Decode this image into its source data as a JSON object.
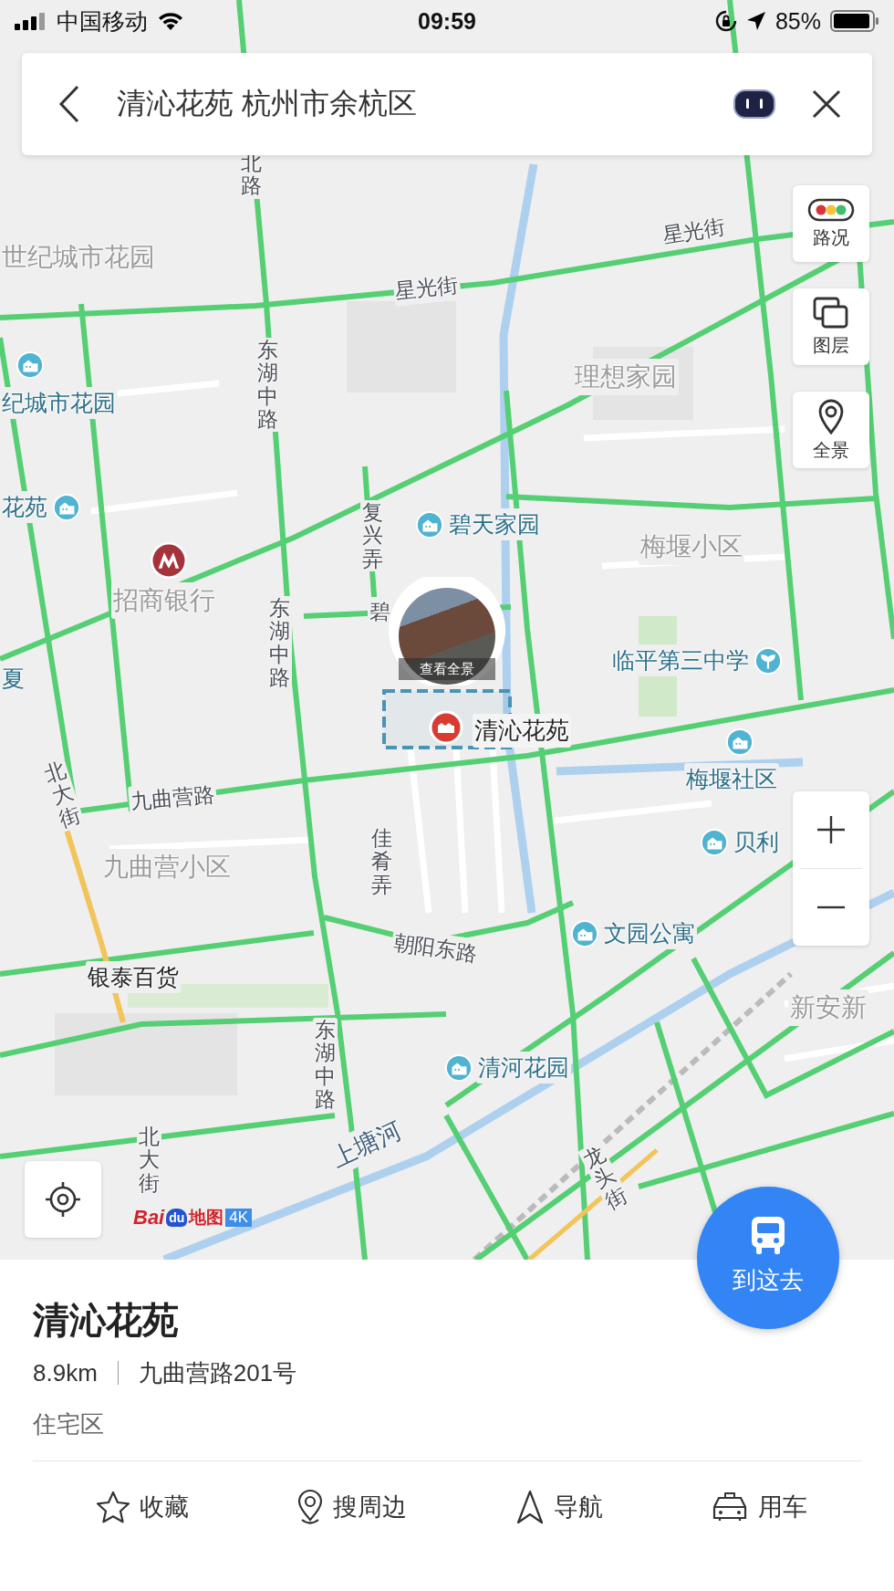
{
  "status_bar": {
    "carrier": "中国移动",
    "time": "09:59",
    "battery": "85%"
  },
  "search": {
    "value": "清沁花苑 杭州市余杭区"
  },
  "map_controls": [
    {
      "label": "路况",
      "kind": "traffic"
    },
    {
      "label": "图层",
      "kind": "layers"
    },
    {
      "label": "全景",
      "kind": "panorama"
    }
  ],
  "map_labels": [
    {
      "text": "北路",
      "kind": "road"
    },
    {
      "text": "世纪城市花园",
      "kind": "district"
    },
    {
      "text": "星光街",
      "kind": "road"
    },
    {
      "text": "星光街",
      "kind": "road"
    },
    {
      "text": "东湖中路",
      "kind": "road"
    },
    {
      "text": "理想家园",
      "kind": "district"
    },
    {
      "text": "纪城市花园",
      "kind": "poi"
    },
    {
      "text": "花苑",
      "kind": "poi"
    },
    {
      "text": "碧天家园",
      "kind": "poi"
    },
    {
      "text": "复兴弄",
      "kind": "road"
    },
    {
      "text": "梅堰小区",
      "kind": "district"
    },
    {
      "text": "招商银行",
      "kind": "metro"
    },
    {
      "text": "东湖中路",
      "kind": "road"
    },
    {
      "text": "碧",
      "kind": "road"
    },
    {
      "text": "临平第三中学",
      "kind": "school"
    },
    {
      "text": "夏",
      "kind": "poi_text"
    },
    {
      "text": "梅堰社区",
      "kind": "poi"
    },
    {
      "text": "北大街",
      "kind": "road"
    },
    {
      "text": "九曲营路",
      "kind": "road"
    },
    {
      "text": "九曲营小区",
      "kind": "district"
    },
    {
      "text": "佳肴弄",
      "kind": "road"
    },
    {
      "text": "贝利",
      "kind": "poi"
    },
    {
      "text": "文园公寓",
      "kind": "poi"
    },
    {
      "text": "朝阳东路",
      "kind": "road"
    },
    {
      "text": "新安新",
      "kind": "district"
    },
    {
      "text": "银泰百货",
      "kind": "mall"
    },
    {
      "text": "东湖中路",
      "kind": "road"
    },
    {
      "text": "清河花园",
      "kind": "poi"
    },
    {
      "text": "上塘河",
      "kind": "river"
    },
    {
      "text": "龙头街",
      "kind": "road"
    },
    {
      "text": "北大街",
      "kind": "road"
    }
  ],
  "pin": {
    "caption": "查看全景",
    "name": "清沁花苑"
  },
  "logo": {
    "brand": "Bai",
    "paw": "du",
    "product": "地图",
    "badge": "4K"
  },
  "go_button": {
    "label": "到这去"
  },
  "place": {
    "name": "清沁花苑",
    "distance": "8.9km",
    "address": "九曲营路201号",
    "category": "住宅区"
  },
  "actions": [
    {
      "label": "收藏",
      "kind": "star"
    },
    {
      "label": "搜周边",
      "kind": "nearby"
    },
    {
      "label": "导航",
      "kind": "navigate"
    },
    {
      "label": "用车",
      "kind": "car"
    }
  ]
}
